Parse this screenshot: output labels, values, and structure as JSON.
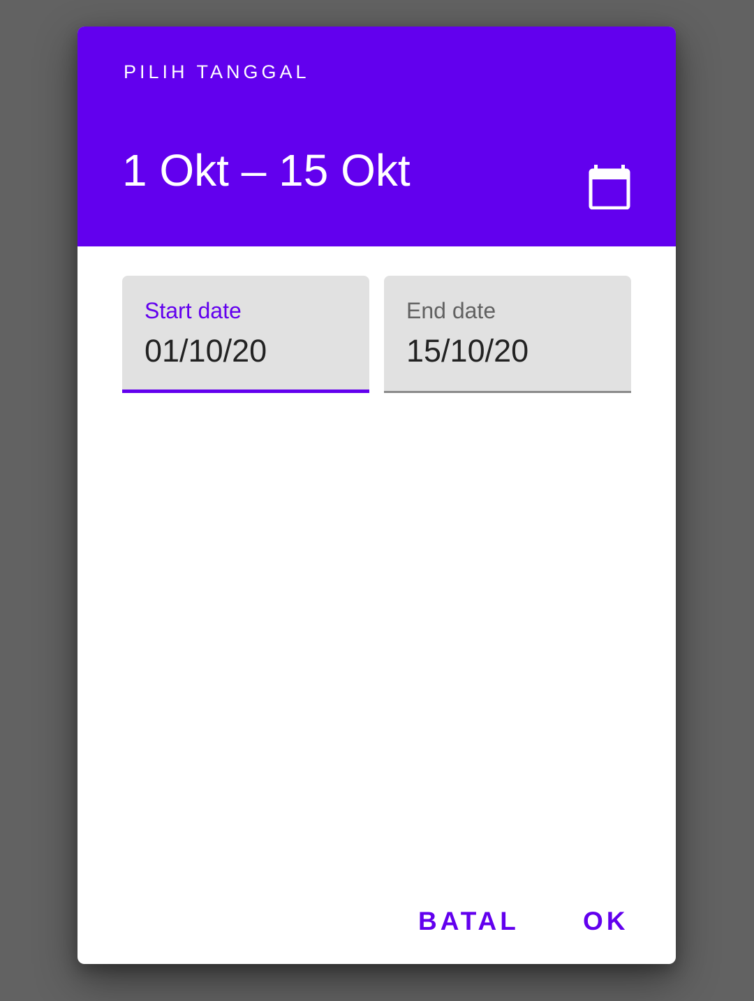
{
  "dialog": {
    "header": {
      "title": "PILIH TANGGAL",
      "selected_range": "1 Okt – 15 Okt",
      "toggle_icon": "calendar-icon"
    },
    "fields": {
      "start": {
        "label": "Start date",
        "value": "01/10/20"
      },
      "end": {
        "label": "End date",
        "value": "15/10/20"
      }
    },
    "actions": {
      "cancel_label": "BATAL",
      "ok_label": "OK"
    }
  },
  "colors": {
    "accent": "#6200ee",
    "scrim": "#626262",
    "field_fill": "#e1e1e1"
  }
}
